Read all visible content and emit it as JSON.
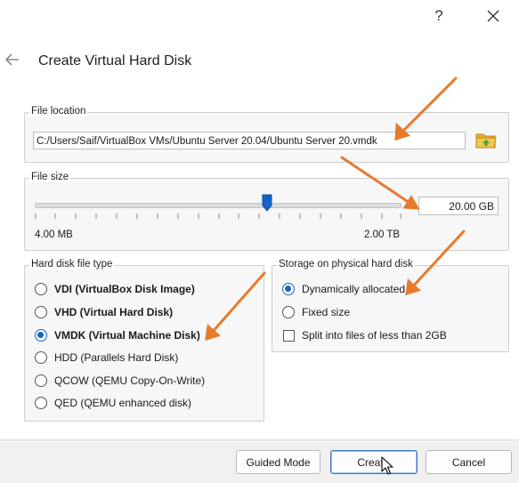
{
  "window": {
    "help_glyph": "?",
    "close_glyph": "✕"
  },
  "header": {
    "title": "Create Virtual Hard Disk"
  },
  "file_location": {
    "label": "File location",
    "path": "C:/Users/Saif/VirtualBox VMs/Ubuntu Server 20.04/Ubuntu Server 20.vmdk"
  },
  "file_size": {
    "label": "File size",
    "value": "20.00 GB",
    "min_label": "4.00 MB",
    "max_label": "2.00 TB",
    "slider_position_fraction": 0.63
  },
  "disk_type": {
    "label": "Hard disk file type",
    "options": [
      {
        "label": "VDI (VirtualBox Disk Image)",
        "selected": false
      },
      {
        "label": "VHD (Virtual Hard Disk)",
        "selected": false
      },
      {
        "label": "VMDK (Virtual Machine Disk)",
        "selected": true
      },
      {
        "label": "HDD (Parallels Hard Disk)",
        "selected": false
      },
      {
        "label": "QCOW (QEMU Copy-On-Write)",
        "selected": false
      },
      {
        "label": "QED (QEMU enhanced disk)",
        "selected": false
      }
    ]
  },
  "storage": {
    "label": "Storage on physical hard disk",
    "options": [
      {
        "label": "Dynamically allocated",
        "selected": true
      },
      {
        "label": "Fixed size",
        "selected": false
      }
    ],
    "split_label": "Split into files of less than 2GB",
    "split_checked": false
  },
  "buttons": {
    "guided_mode": "Guided Mode",
    "create": "Creat",
    "cancel": "Cancel"
  },
  "colors": {
    "accent": "#1464c8",
    "annotation_arrow": "#e87a2e",
    "folder_icon": "#e9b22c"
  }
}
